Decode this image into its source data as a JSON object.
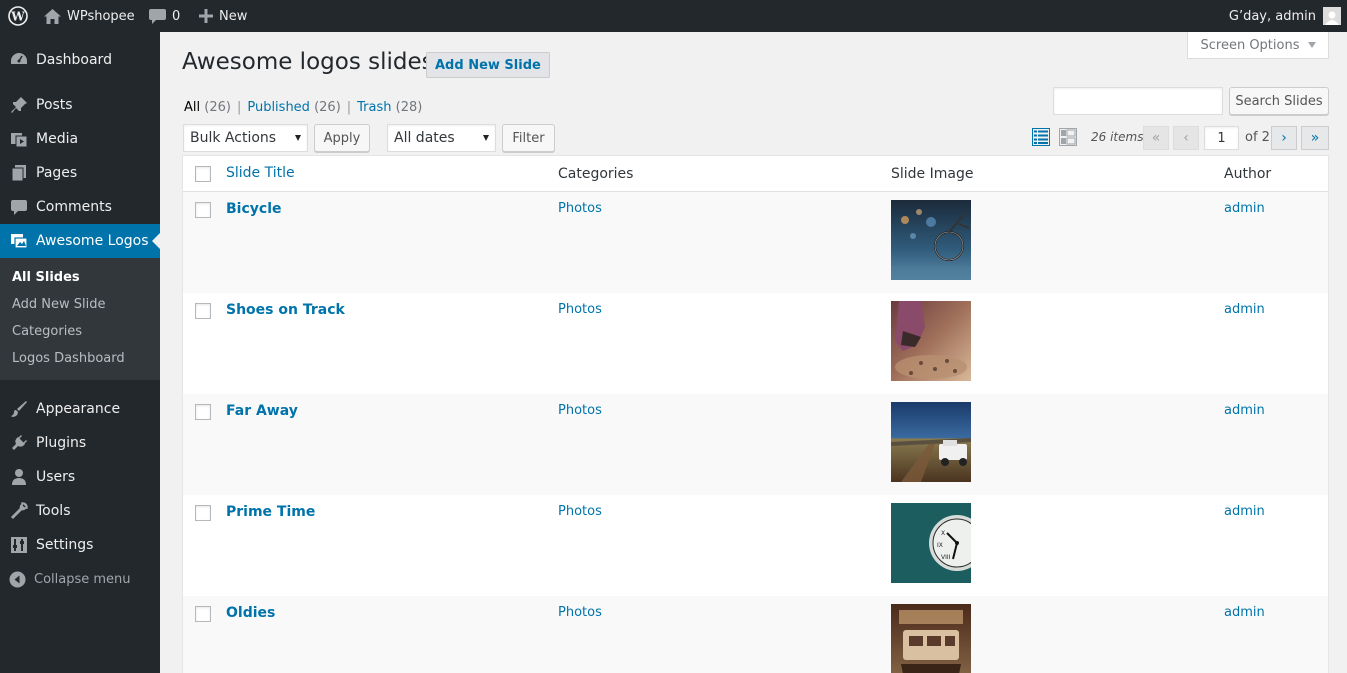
{
  "admin_bar": {
    "site_name": "WPshopee",
    "comments_count": "0",
    "new_label": "New",
    "greeting": "G’day, admin"
  },
  "sidebar": {
    "items": [
      {
        "label": "Dashboard",
        "icon": "dashboard-icon"
      },
      {
        "label": "Posts",
        "icon": "pin-icon"
      },
      {
        "label": "Media",
        "icon": "media-icon"
      },
      {
        "label": "Pages",
        "icon": "pages-icon"
      },
      {
        "label": "Comments",
        "icon": "comment-icon"
      },
      {
        "label": "Awesome Logos",
        "icon": "images-icon",
        "current": true
      },
      {
        "label": "Appearance",
        "icon": "paintbrush-icon"
      },
      {
        "label": "Plugins",
        "icon": "plugin-icon"
      },
      {
        "label": "Users",
        "icon": "user-icon"
      },
      {
        "label": "Tools",
        "icon": "wrench-icon"
      },
      {
        "label": "Settings",
        "icon": "settings-icon"
      }
    ],
    "submenu": [
      "All Slides",
      "Add New Slide",
      "Categories",
      "Logos Dashboard"
    ],
    "collapse_label": "Collapse menu"
  },
  "screen_options_label": "Screen Options",
  "page": {
    "title": "Awesome logos slides",
    "add_new_label": "Add New Slide"
  },
  "filters": {
    "all_label": "All",
    "all_count": "(26)",
    "published_label": "Published",
    "published_count": "(26)",
    "trash_label": "Trash",
    "trash_count": "(28)"
  },
  "search": {
    "value": "",
    "button_label": "Search Slides"
  },
  "toolbar": {
    "bulk_actions": "Bulk Actions",
    "apply_label": "Apply",
    "dates": "All dates",
    "filter_label": "Filter"
  },
  "pagination": {
    "items": "26 items",
    "first": "«",
    "prev": "‹",
    "current": "1",
    "of_total": "of 2",
    "next": "›",
    "last": "»"
  },
  "table": {
    "columns": [
      "Slide Title",
      "Categories",
      "Slide Image",
      "Author"
    ],
    "rows": [
      {
        "title": "Bicycle",
        "category": "Photos",
        "author": "admin"
      },
      {
        "title": "Shoes on Track",
        "category": "Photos",
        "author": "admin"
      },
      {
        "title": "Far Away",
        "category": "Photos",
        "author": "admin"
      },
      {
        "title": "Prime Time",
        "category": "Photos",
        "author": "admin"
      },
      {
        "title": "Oldies",
        "category": "Photos",
        "author": "admin"
      }
    ]
  },
  "colors": {
    "admin_bar": "#23282d",
    "accent": "#0073aa",
    "background": "#f1f1f1"
  }
}
